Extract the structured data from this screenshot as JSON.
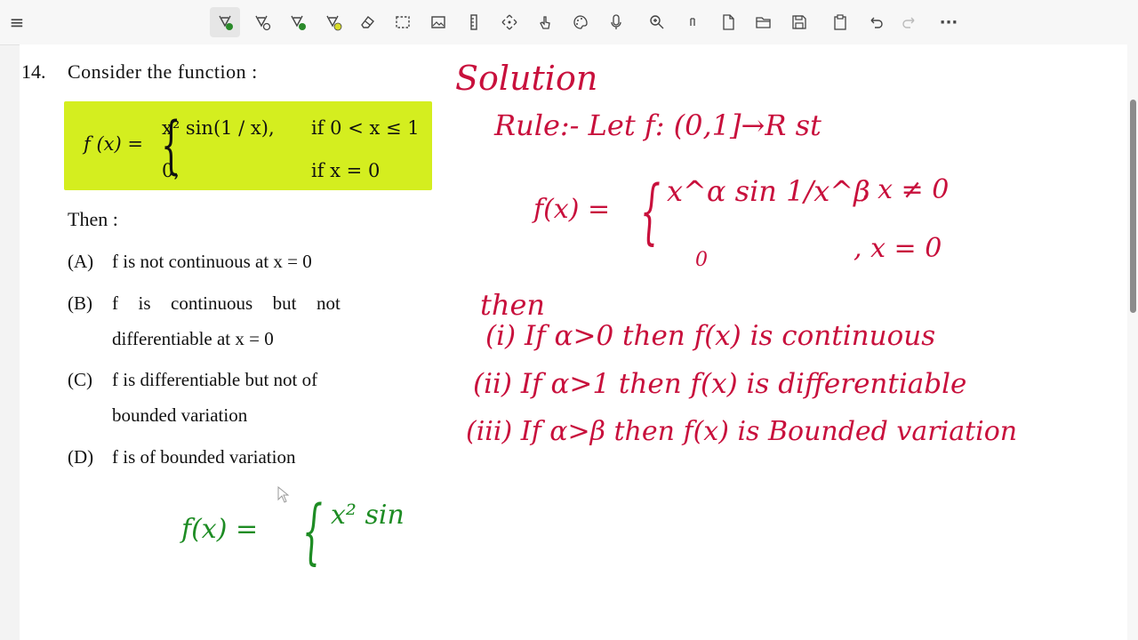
{
  "toolbar": {
    "icons": [
      "menu-icon",
      "pen-green-icon",
      "pen-outline-icon",
      "pen-green-2-icon",
      "pen-yellow-icon",
      "eraser-icon",
      "lasso-select-icon",
      "image-icon",
      "ruler-icon",
      "move-icon",
      "touch-icon",
      "palette-icon",
      "microphone-icon",
      "zoom-icon",
      "text-cursor-icon",
      "new-page-icon",
      "open-folder-icon",
      "save-icon",
      "clipboard-icon",
      "undo-icon",
      "redo-icon",
      "more-icon"
    ],
    "more_label": "···",
    "menu_label": "≡"
  },
  "question": {
    "number": "14.",
    "prompt": "Consider the function :",
    "fx": "f (x) =",
    "case1_expr": "x² sin(1 / x),",
    "case1_cond": "if 0 < x ≤ 1",
    "case2_expr": "0,",
    "case2_cond": "if x = 0",
    "then": "Then :",
    "options": [
      {
        "label": "(A)",
        "text_line1": "f is not continuous at x = 0",
        "text_line2": ""
      },
      {
        "label": "(B)",
        "text_line1": "f  is  continuous  but  not",
        "text_line2": "differentiable at x = 0"
      },
      {
        "label": "(C)",
        "text_line1": "f is differentiable but not of",
        "text_line2": "bounded variation"
      },
      {
        "label": "(D)",
        "text_line1": "f is of bounded variation",
        "text_line2": ""
      }
    ]
  },
  "handwriting": {
    "solution": "Solution",
    "rule": "Rule:- Let f: (0,1]→R  st",
    "fx_def": "f(x) =",
    "case1": "x^α sin 1/x^β",
    "case1_cond": ", x ≠ 0",
    "case2": "0",
    "case2_cond": ", x = 0",
    "then": "then",
    "i": "(i)  If α>0  then f(x) is continuous",
    "ii": "(ii)  If α>1  then f(x) is differentiable",
    "iii": "(iii)  If α>β  then f(x) is Bounded variation",
    "green_fx": "f(x) =",
    "green_expr": "x² sin"
  },
  "colors": {
    "highlight": "#d4ee1f",
    "ink_red": "#c8103c",
    "ink_green": "#1e8c24"
  }
}
